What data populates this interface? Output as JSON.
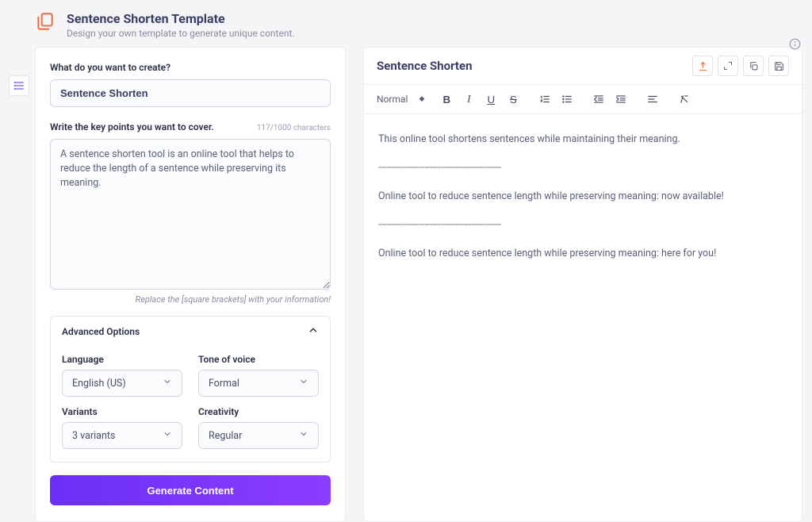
{
  "header": {
    "title": "Sentence Shorten Template",
    "subtitle": "Design your own template to generate unique content."
  },
  "leftPanel": {
    "createLabel": "What do you want to create?",
    "createValue": "Sentence Shorten",
    "pointsLabel": "Write the key points you want to cover.",
    "charCount": "117/1000 characters",
    "pointsValue": "A sentence shorten tool is an online tool that helps to reduce the length of a sentence while preserving its meaning.",
    "hint": "Replace the [square brackets] with your information!",
    "advancedTitle": "Advanced Options",
    "language": {
      "label": "Language",
      "value": "English (US)"
    },
    "tone": {
      "label": "Tone of voice",
      "value": "Formal"
    },
    "variants": {
      "label": "Variants",
      "value": "3 variants"
    },
    "creativity": {
      "label": "Creativity",
      "value": "Regular"
    },
    "generateBtn": "Generate Content"
  },
  "editor": {
    "title": "Sentence Shorten",
    "formatLabel": "Normal",
    "content": {
      "p1": "This online tool shortens sentences while maintaining their meaning.",
      "sep": "---------------------------------------------",
      "p2": "Online tool to reduce sentence length while preserving meaning: now available!",
      "p3": "Online tool to reduce sentence length while preserving meaning: here for you!"
    }
  }
}
